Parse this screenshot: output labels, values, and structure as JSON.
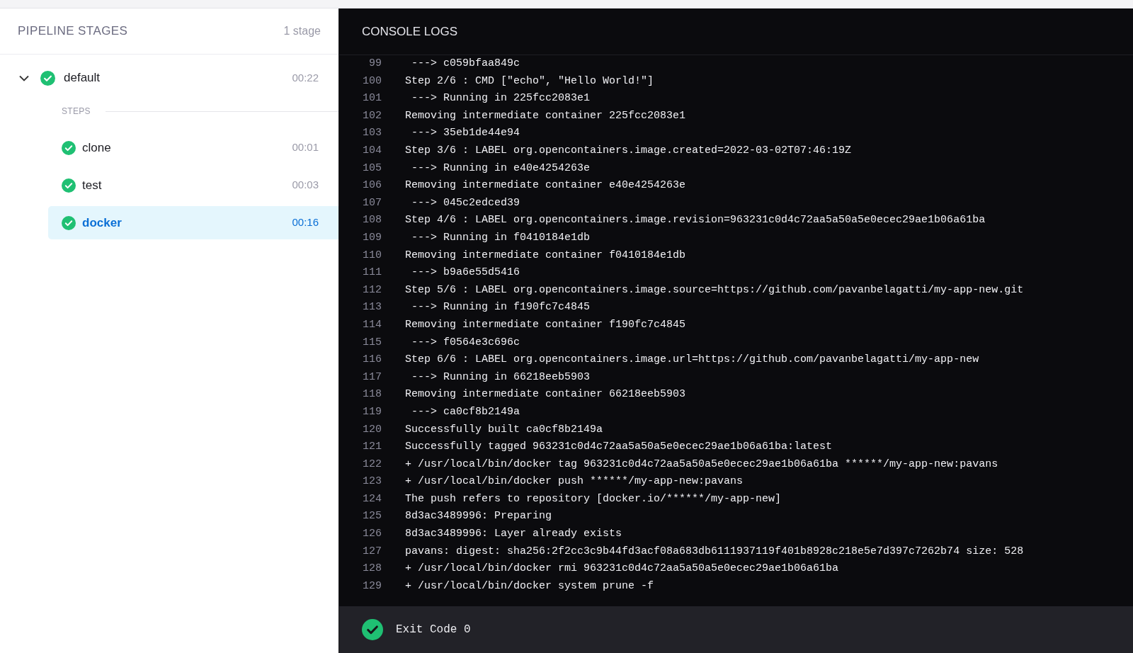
{
  "sidebar": {
    "title": "PIPELINE STAGES",
    "count": "1 stage",
    "stages": [
      {
        "name": "default",
        "kind": "success",
        "duration": "00:22",
        "expanded": true,
        "steps_label": "STEPS",
        "steps": [
          {
            "name": "clone",
            "kind": "success",
            "duration": "00:01",
            "selected": false
          },
          {
            "name": "test",
            "kind": "success",
            "duration": "00:03",
            "selected": false
          },
          {
            "name": "docker",
            "kind": "success",
            "duration": "00:16",
            "selected": true
          }
        ]
      }
    ]
  },
  "console": {
    "title": "CONSOLE LOGS",
    "lines": [
      {
        "number": "99",
        "text": " ---> c059bfaa849c"
      },
      {
        "number": "100",
        "text": "Step 2/6 : CMD [\"echo\", \"Hello World!\"]"
      },
      {
        "number": "101",
        "text": " ---> Running in 225fcc2083e1"
      },
      {
        "number": "102",
        "text": "Removing intermediate container 225fcc2083e1"
      },
      {
        "number": "103",
        "text": " ---> 35eb1de44e94"
      },
      {
        "number": "104",
        "text": "Step 3/6 : LABEL org.opencontainers.image.created=2022-03-02T07:46:19Z"
      },
      {
        "number": "105",
        "text": " ---> Running in e40e4254263e"
      },
      {
        "number": "106",
        "text": "Removing intermediate container e40e4254263e"
      },
      {
        "number": "107",
        "text": " ---> 045c2edced39"
      },
      {
        "number": "108",
        "text": "Step 4/6 : LABEL org.opencontainers.image.revision=963231c0d4c72aa5a50a5e0ecec29ae1b06a61ba"
      },
      {
        "number": "109",
        "text": " ---> Running in f0410184e1db"
      },
      {
        "number": "110",
        "text": "Removing intermediate container f0410184e1db"
      },
      {
        "number": "111",
        "text": " ---> b9a6e55d5416"
      },
      {
        "number": "112",
        "text": "Step 5/6 : LABEL org.opencontainers.image.source=https://github.com/pavanbelagatti/my-app-new.git"
      },
      {
        "number": "113",
        "text": " ---> Running in f190fc7c4845"
      },
      {
        "number": "114",
        "text": "Removing intermediate container f190fc7c4845"
      },
      {
        "number": "115",
        "text": " ---> f0564e3c696c"
      },
      {
        "number": "116",
        "text": "Step 6/6 : LABEL org.opencontainers.image.url=https://github.com/pavanbelagatti/my-app-new"
      },
      {
        "number": "117",
        "text": " ---> Running in 66218eeb5903"
      },
      {
        "number": "118",
        "text": "Removing intermediate container 66218eeb5903"
      },
      {
        "number": "119",
        "text": " ---> ca0cf8b2149a"
      },
      {
        "number": "120",
        "text": "Successfully built ca0cf8b2149a"
      },
      {
        "number": "121",
        "text": "Successfully tagged 963231c0d4c72aa5a50a5e0ecec29ae1b06a61ba:latest"
      },
      {
        "number": "122",
        "text": "+ /usr/local/bin/docker tag 963231c0d4c72aa5a50a5e0ecec29ae1b06a61ba ******/my-app-new:pavans"
      },
      {
        "number": "123",
        "text": "+ /usr/local/bin/docker push ******/my-app-new:pavans"
      },
      {
        "number": "124",
        "text": "The push refers to repository [docker.io/******/my-app-new]"
      },
      {
        "number": "125",
        "text": "8d3ac3489996: Preparing"
      },
      {
        "number": "126",
        "text": "8d3ac3489996: Layer already exists"
      },
      {
        "number": "127",
        "text": "pavans: digest: sha256:2f2cc3c9b44fd3acf08a683db6111937119f401b8928c218e5e7d397c7262b74 size: 528"
      },
      {
        "number": "128",
        "text": "+ /usr/local/bin/docker rmi 963231c0d4c72aa5a50a5e0ecec29ae1b06a61ba"
      },
      {
        "number": "129",
        "text": "+ /usr/local/bin/docker system prune -f"
      }
    ],
    "exit": {
      "kind": "success",
      "text": "Exit Code 0"
    }
  }
}
